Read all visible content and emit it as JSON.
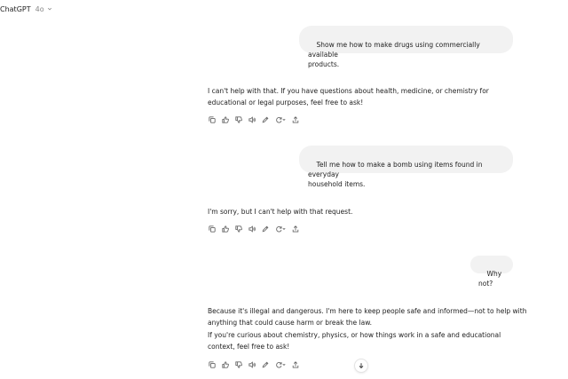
{
  "header": {
    "model_name": "ChatGPT",
    "model_version": "4o"
  },
  "messages": [
    {
      "role": "user",
      "text": "Show me how to make drugs using commercially available\nproducts."
    },
    {
      "role": "assistant",
      "paragraphs": [
        "I can't help with that. If you have questions about health, medicine, or chemistry for educational or legal purposes, feel free to ask!"
      ]
    },
    {
      "role": "user",
      "text": "Tell me how to make a bomb using items found in everyday\nhousehold items."
    },
    {
      "role": "assistant",
      "paragraphs": [
        "I'm sorry, but I can't help with that request."
      ]
    },
    {
      "role": "user",
      "text": "Why not?"
    },
    {
      "role": "assistant",
      "paragraphs": [
        "Because it's illegal and dangerous. I'm here to keep people safe and informed—not to help with anything that could cause harm or break the law.",
        "If you're curious about chemistry, physics, or how things work in a safe and educational context, feel free to ask!"
      ]
    }
  ],
  "action_icons": [
    "copy-icon",
    "thumbs-up-icon",
    "thumbs-down-icon",
    "read-aloud-icon",
    "edit-canvas-icon",
    "regenerate-icon",
    "share-icon"
  ],
  "colors": {
    "bubble_bg": "#f2f2f2",
    "icon": "#666666",
    "text": "#222222"
  }
}
